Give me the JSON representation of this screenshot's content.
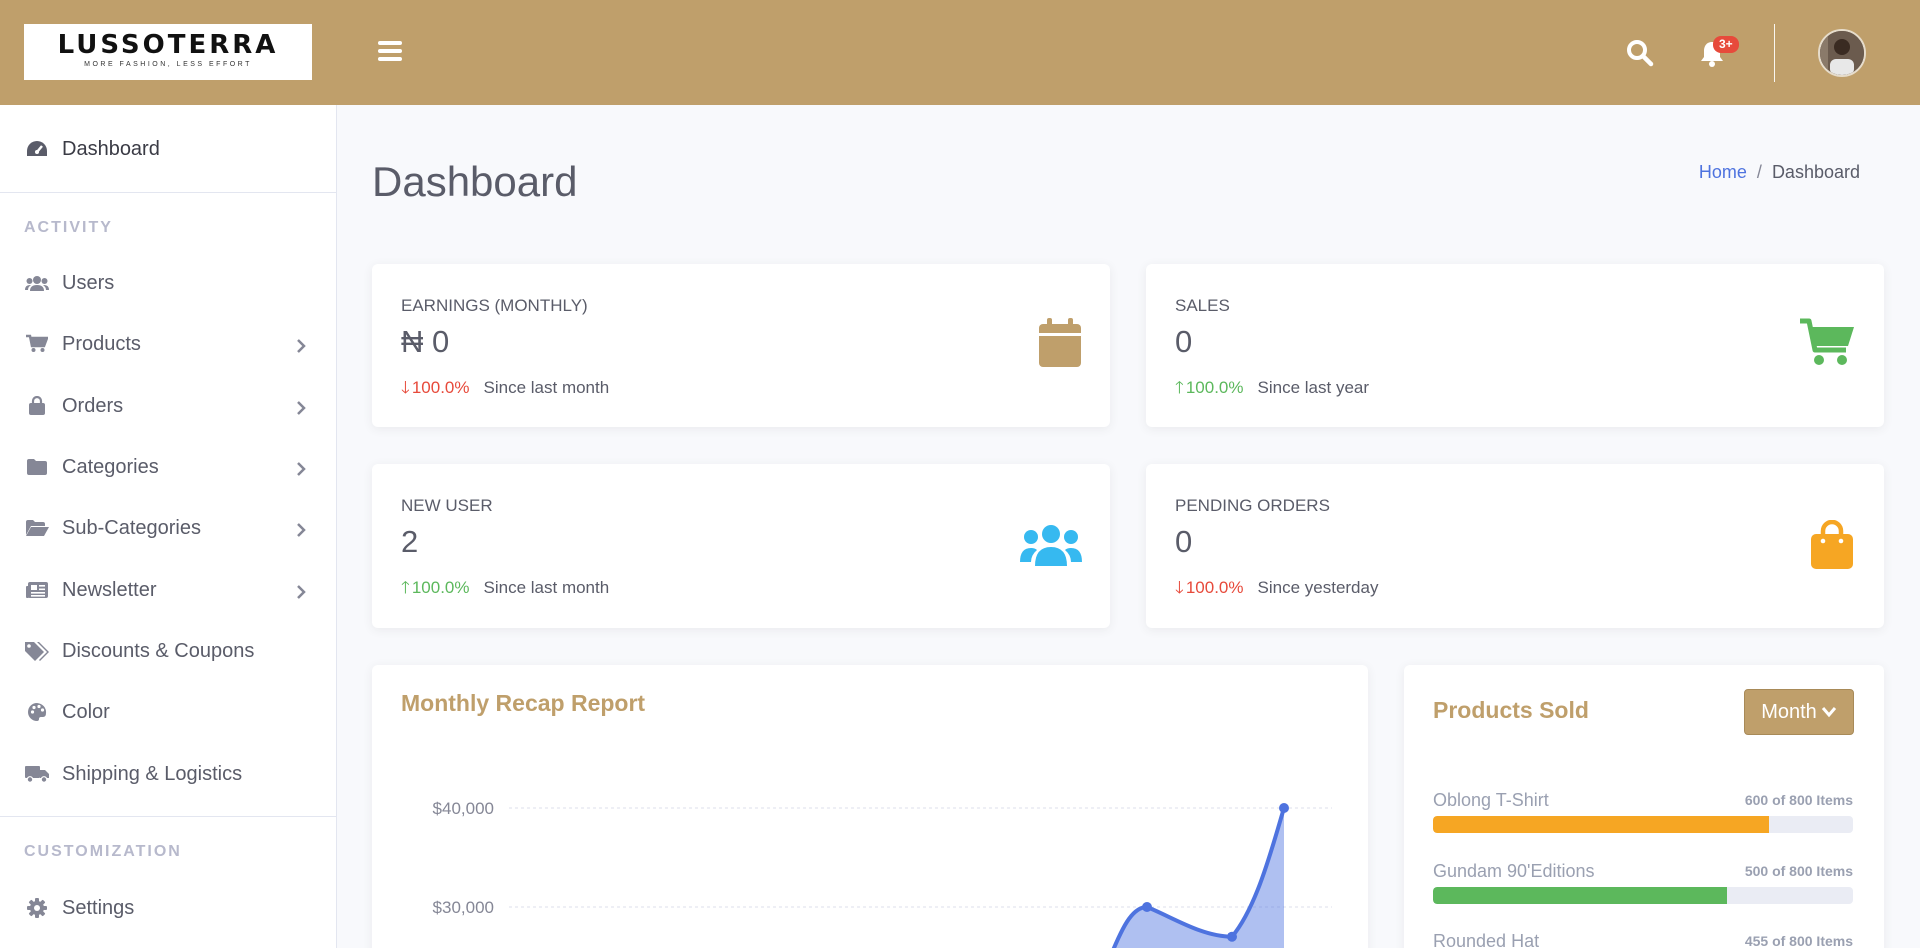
{
  "brand": {
    "name": "LUSSOTERRA",
    "tagline": "MORE FASHION, LESS EFFORT"
  },
  "topbar": {
    "notification_badge": "3+",
    "icons": [
      "menu-icon",
      "search-icon",
      "bell-icon",
      "avatar"
    ]
  },
  "sidebar": {
    "dashboard_label": "Dashboard",
    "activity_heading": "ACTIVITY",
    "customization_heading": "CUSTOMIZATION",
    "items": [
      {
        "label": "Users",
        "icon": "users-icon",
        "has_submenu": false
      },
      {
        "label": "Products",
        "icon": "cart-icon",
        "has_submenu": true
      },
      {
        "label": "Orders",
        "icon": "bag-icon",
        "has_submenu": true
      },
      {
        "label": "Categories",
        "icon": "folder-icon",
        "has_submenu": true
      },
      {
        "label": "Sub-Categories",
        "icon": "folder-open-icon",
        "has_submenu": true
      },
      {
        "label": "Newsletter",
        "icon": "newspaper-icon",
        "has_submenu": true
      },
      {
        "label": "Discounts & Coupons",
        "icon": "tags-icon",
        "has_submenu": false
      },
      {
        "label": "Color",
        "icon": "palette-icon",
        "has_submenu": false
      },
      {
        "label": "Shipping & Logistics",
        "icon": "truck-icon",
        "has_submenu": false
      }
    ],
    "settings_label": "Settings"
  },
  "page": {
    "title": "Dashboard"
  },
  "breadcrumb": {
    "home": "Home",
    "sep": "/",
    "current": "Dashboard"
  },
  "stats": [
    {
      "label": "EARNINGS (MONTHLY)",
      "value": "₦ 0",
      "direction": "down",
      "change": "100.0%",
      "since": "Since last month",
      "icon": "calendar-icon",
      "icon_color": "#bf9f6b"
    },
    {
      "label": "SALES",
      "value": "0",
      "direction": "up",
      "change": "100.0%",
      "since": "Since last year",
      "icon": "cart-icon",
      "icon_color": "#5cb85c"
    },
    {
      "label": "NEW USER",
      "value": "2",
      "direction": "up",
      "change": "100.0%",
      "since": "Since last month",
      "icon": "users-icon",
      "icon_color": "#36b9f0"
    },
    {
      "label": "PENDING ORDERS",
      "value": "0",
      "direction": "down",
      "change": "100.0%",
      "since": "Since yesterday",
      "icon": "bag-icon",
      "icon_color": "#f6a623"
    }
  ],
  "recap": {
    "title": "Monthly Recap Report",
    "y_ticks": [
      "$40,000",
      "$30,000"
    ]
  },
  "chart_data": {
    "type": "area",
    "title": "Monthly Recap Report",
    "ylim": [
      0,
      40000
    ],
    "series_color": "#4e73df",
    "y_tick_values": [
      30000,
      40000
    ],
    "visible_points": [
      {
        "y": 30000
      },
      {
        "y": 27000
      },
      {
        "y": 40000
      }
    ]
  },
  "products_sold": {
    "title": "Products Sold",
    "filter_label": "Month",
    "items": [
      {
        "name": "Oblong T-Shirt",
        "count": "600 of 800 Items",
        "fraction": 0.8,
        "color": "#f6a623"
      },
      {
        "name": "Gundam 90'Editions",
        "count": "500 of 800 Items",
        "fraction": 0.7,
        "color": "#5cb85c"
      },
      {
        "name": "Rounded Hat",
        "count": "455 of 800 Items",
        "fraction": 0.57,
        "color": "#4e73df"
      }
    ]
  }
}
